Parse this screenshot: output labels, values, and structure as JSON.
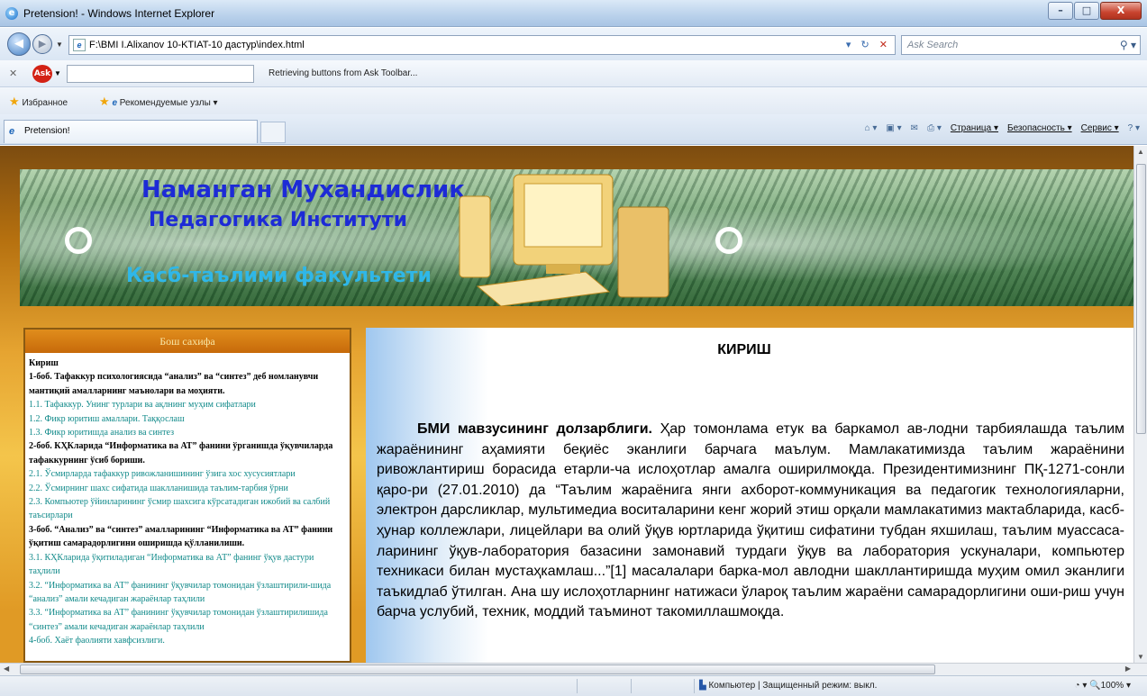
{
  "window": {
    "title": "Pretension! - Windows Internet Explorer",
    "minimize": "–",
    "maximize": "□",
    "close": "X"
  },
  "address": {
    "url": "F:\\BMI I.Alixanov 10-KTIAT-10 дастур\\index.html",
    "search_placeholder": "Ask Search"
  },
  "ask_toolbar": {
    "status": "Retrieving buttons from Ask Toolbar...",
    "logo": "Ask"
  },
  "favorites": {
    "favorites_label": "Избранное",
    "suggested_label": "Рекомендуемые узлы ▾"
  },
  "tab": {
    "label": "Pretension!"
  },
  "command_bar": {
    "page": "Страница ▾",
    "safety": "Безопасность ▾",
    "tools": "Сервис ▾"
  },
  "banner": {
    "line1": "Наманган Мухандислик",
    "line2": "Педагогика Институти",
    "line3": "Касб-таълими факультети"
  },
  "left_panel": {
    "header": "Бош сахифа",
    "items": [
      {
        "text": "Кириш",
        "style": "b"
      },
      {
        "text": "1-боб. Тафаккур психологиясида “анализ” ва “синтез” деб номланувчи мантиқий амалларнинг маънолари ва моҳияти.",
        "style": "b"
      },
      {
        "text": "1.1. Тафаккур. Унинг турлари ва ақлнинг муҳим сифатлари",
        "style": "l"
      },
      {
        "text": "1.2. Фикр юритиш амаллари. Таққослаш",
        "style": "l"
      },
      {
        "text": "1.3. Фикр юритишда анализ ва синтез",
        "style": "l"
      },
      {
        "text": "2-боб. КҲКларида “Информатика ва АТ” фанини ўрганишда ўқувчиларда тафаккурнинг ўсиб бориши.",
        "style": "b"
      },
      {
        "text": "2.1. Ўсмирларда тафаккур ривожланишининг ўзига хос хусусиятлари",
        "style": "l"
      },
      {
        "text": "2.2. Ўсмирнинг шахс сифатида шаклланишида таълим-тарбия ўрни",
        "style": "l"
      },
      {
        "text": "2.3. Компьютер ўйинларининг ўсмир шахсига кўрсатадиган ижобий ва салбий таъсирлари",
        "style": "l"
      },
      {
        "text": "3-боб. “Анализ” ва “синтез” амалларининг “Информатика ва АТ” фанини ўқитиш самарадорлигини оширишда қўлланилиши.",
        "style": "b"
      },
      {
        "text": "3.1. КҲКларида ўқитиладиган “Информатика ва АТ” фанинг ўқув дастури таҳлили",
        "style": "l"
      },
      {
        "text": "3.2. “Информатика ва АТ” фанининг ўқувчилар томонидан ўзлаштирили-шида “анализ” амали кечадиган жараёнлар таҳлили",
        "style": "l"
      },
      {
        "text": "3.3. “Информатика ва АТ” фанининг ўқувчилар томонидан ўзлаштирилишида “синтез” амали кечадиган жараёнлар таҳлили",
        "style": "l"
      },
      {
        "text": "4-боб. Хаёт фаолияти хавфсизлиги.",
        "style": "l"
      }
    ]
  },
  "content": {
    "title": "КИРИШ",
    "lead": "БМИ мавзусининг долзарблиги.",
    "body": " Ҳар томонлама етук ва баркамол ав-лодни тарбиялашда таълим жараёнининг аҳамияти беқиёс эканлиги барчага маълум. Мамлакатимизда таълим жараёнини ривожлантириш борасида етарли-ча ислоҳотлар амалга оширилмоқда. Президентимизнинг ПҚ-1271-сонли қаро-ри (27.01.2010) да “Таълим жараёнига янги ахборот-коммуникация ва педагогик технологияларни, электрон дарсликлар, мультимедиа воситаларини кенг жорий этиш орқали мамлакатимиз мактабларида, касб-ҳунар коллежлари, лицейлари ва олий ўқув юртларида ўқитиш сифатини тубдан яхшилаш, таълим муассаса-ларининг ўқув-лаборатория базасини замонавий турдаги ўқув ва лаборатория ускуналари, компьютер техникаси билан мустаҳкамлаш...”[1] масалалари барка-мол авлодни шакллантиришда муҳим омил эканлиги таъкидлаб ўтилган. Ана шу ислоҳотларнинг натижаси ўлароқ таълим жараёни самарадорлигини оши-риш учун барча услубий, техник, моддий таъминот такомиллашмоқда."
  },
  "statusbar": {
    "zone": "Компьютер | Защищенный режим: выкл.",
    "zoom": "100%"
  },
  "colors": {
    "banner_title": "#1d2bd6",
    "banner_sub": "#2fb7e8",
    "toc_link": "#118a8a",
    "panel_header": "#c76a0a"
  }
}
